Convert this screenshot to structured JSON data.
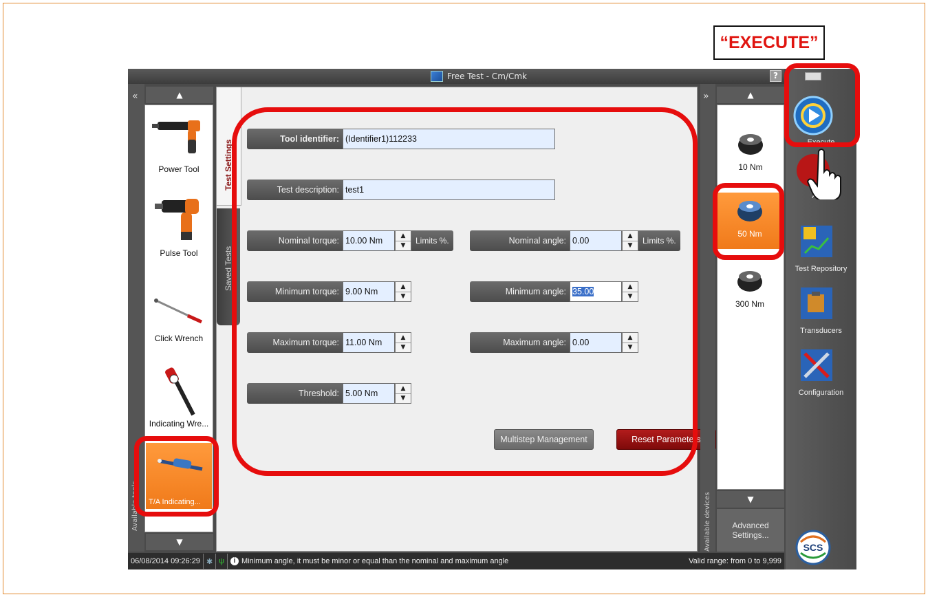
{
  "annotation": {
    "execute_label": "“EXECUTE”"
  },
  "window": {
    "title": "Free Test - Cm/Cmk",
    "help": "?"
  },
  "left_panel": {
    "collapse": "«",
    "vertical_label": "Available tools",
    "tools": [
      {
        "label": "Power Tool",
        "icon": "power-tool-icon"
      },
      {
        "label": "Pulse Tool",
        "icon": "pulse-tool-icon"
      },
      {
        "label": "Click Wrench",
        "icon": "click-wrench-icon"
      },
      {
        "label": "Indicating Wre...",
        "icon": "indicating-wrench-icon"
      },
      {
        "label": "T/A Indicating...",
        "icon": "ta-indicating-icon",
        "selected": true
      }
    ]
  },
  "tabs": {
    "settings": "Test Settings",
    "saved": "Saved Tests"
  },
  "form": {
    "tool_identifier": {
      "label": "Tool identifier:",
      "value": "(Identifier1)112233"
    },
    "test_description": {
      "label": "Test description:",
      "value": "test1"
    },
    "nominal_torque": {
      "label": "Nominal torque:",
      "value": "10.00 Nm",
      "limits": "Limits %."
    },
    "minimum_torque": {
      "label": "Minimum torque:",
      "value": "9.00 Nm"
    },
    "maximum_torque": {
      "label": "Maximum torque:",
      "value": "11.00 Nm"
    },
    "threshold": {
      "label": "Threshold:",
      "value": "5.00 Nm"
    },
    "nominal_angle": {
      "label": "Nominal angle:",
      "value": "0.00",
      "limits": "Limits %."
    },
    "minimum_angle": {
      "label": "Minimum angle:",
      "value": "35.00"
    },
    "maximum_angle": {
      "label": "Maximum angle:",
      "value": "0.00"
    },
    "multistep_label": "Multistep Management",
    "reset_label": "Reset Parameters"
  },
  "right_panel": {
    "collapse": "»",
    "vertical_label": "Available devices",
    "devices": [
      {
        "label": "10 Nm"
      },
      {
        "label": "50 Nm",
        "selected": true
      },
      {
        "label": "300 Nm"
      }
    ],
    "advanced": "Advanced Settings..."
  },
  "actions": {
    "execute": "Execute",
    "abort": "Abort",
    "repository": "Test Repository",
    "transducers": "Transducers",
    "configuration": "Configuration",
    "logo": "SCS"
  },
  "status": {
    "datetime": "06/08/2014 09:26:29",
    "message": "Minimum angle, it must be minor or equal than the nominal and maximum angle",
    "range": "Valid range: from 0 to 9,999"
  },
  "colors": {
    "accent_orange": "#f07a1a",
    "annotation_red": "#e60d0d",
    "field_bg": "#e4efff",
    "reset_red": "#9a1212"
  }
}
